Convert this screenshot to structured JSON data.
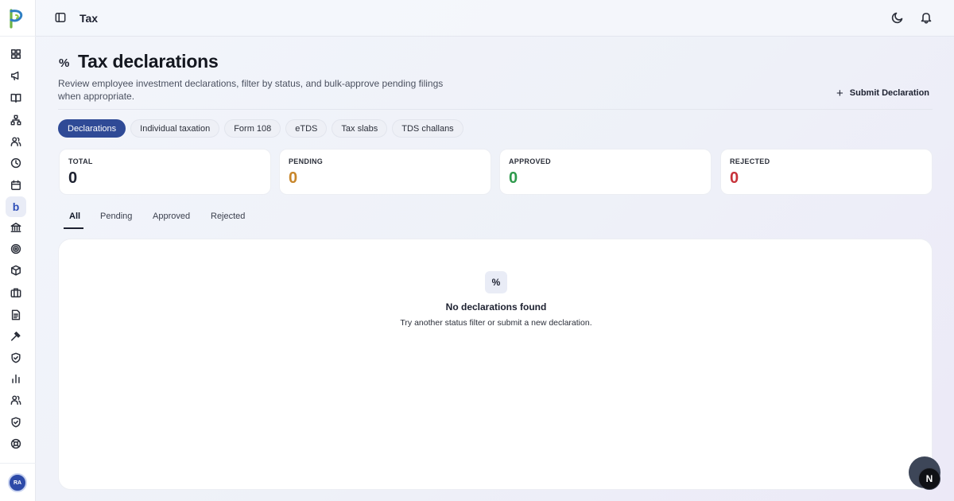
{
  "topbar": {
    "title": "Tax"
  },
  "header": {
    "icon": "percent-icon",
    "title": "Tax declarations",
    "description": "Review employee investment declarations, filter by status, and bulk-approve pending filings when appropriate.",
    "submit_label": "Submit Declaration"
  },
  "pills": [
    {
      "label": "Declarations",
      "active": true
    },
    {
      "label": "Individual taxation"
    },
    {
      "label": "Form 108"
    },
    {
      "label": "eTDS"
    },
    {
      "label": "Tax slabs"
    },
    {
      "label": "TDS challans"
    }
  ],
  "stats": [
    {
      "label": "TOTAL",
      "value": "0",
      "color": "#1d2130"
    },
    {
      "label": "PENDING",
      "value": "0",
      "color": "#c8862a"
    },
    {
      "label": "APPROVED",
      "value": "0",
      "color": "#2e9a4c"
    },
    {
      "label": "REJECTED",
      "value": "0",
      "color": "#c7323a"
    }
  ],
  "subtabs": [
    {
      "label": "All",
      "active": true
    },
    {
      "label": "Pending"
    },
    {
      "label": "Approved"
    },
    {
      "label": "Rejected"
    }
  ],
  "empty": {
    "icon": "percent-icon",
    "title": "No declarations found",
    "subtitle": "Try another status filter or submit a new declaration."
  },
  "user": {
    "initials": "RA"
  },
  "fab": {
    "label": "N"
  },
  "colors": {
    "accent": "#2f4a96",
    "pending": "#c8862a",
    "approved": "#2e9a4c",
    "rejected": "#c7323a"
  }
}
